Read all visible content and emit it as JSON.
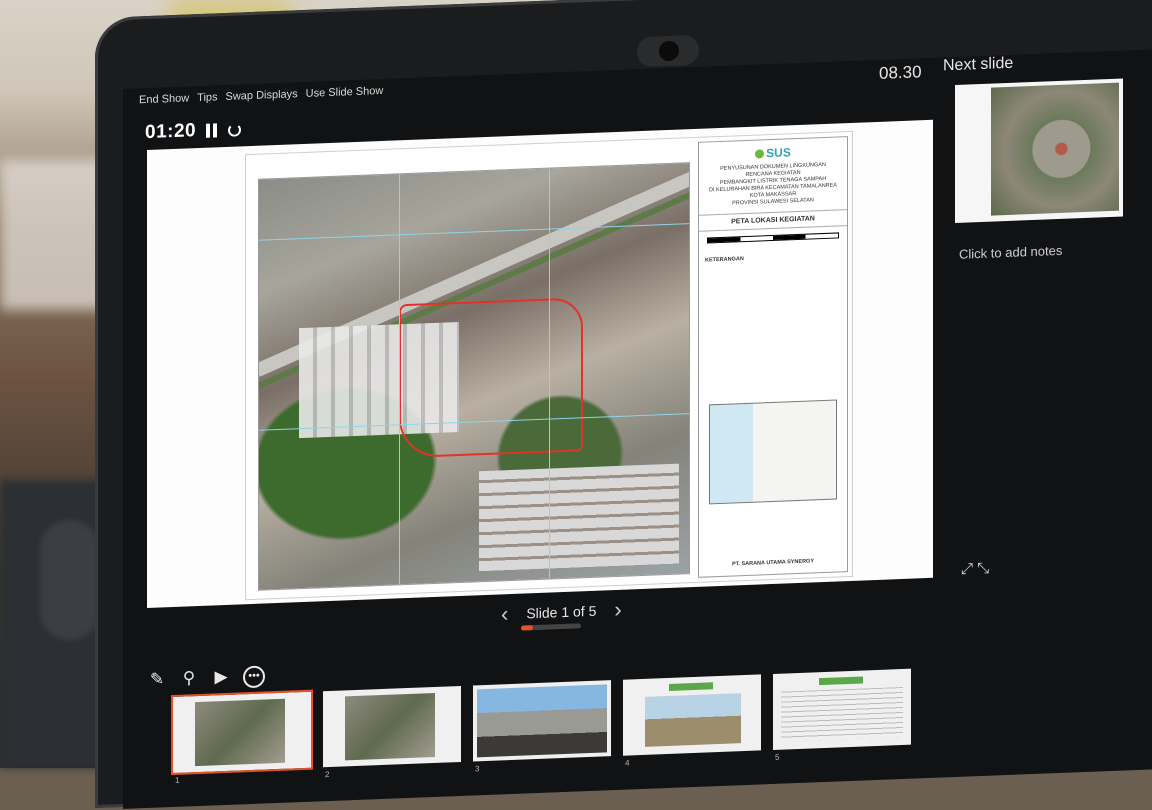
{
  "topbar": {
    "menu": [
      "End Show",
      "Tips",
      "Swap Displays",
      "Use Slide Show"
    ],
    "clock": "08.30",
    "timer": "01:20"
  },
  "slide": {
    "logo_text": "SUS",
    "header_lines": [
      "PENYUSUNAN DOKUMEN LINGKUNGAN",
      "RENCANA KEGIATAN",
      "PEMBANGKIT LISTRIK TENAGA SAMPAH",
      "DI KELURAHAN BIRA KECAMATAN TAMALANREA",
      "KOTA MAKASSAR",
      "PROVINSI SULAWESI SELATAN"
    ],
    "map_title": "PETA LOKASI KEGIATAN",
    "legend_heading": "KETERANGAN",
    "footer_company": "PT. SARANA UTAMA SYNERGY"
  },
  "navigation": {
    "label": "Slide 1 of 5",
    "progress": 0.2
  },
  "next_slide": {
    "label": "Next slide"
  },
  "notes": {
    "placeholder": "Click to add notes"
  },
  "tools": {
    "pen": "pen-icon",
    "zoom": "zoom-icon",
    "pointer": "pointer-icon",
    "more": "more-icon"
  },
  "thumbnails": [
    {
      "num": "1",
      "selected": true
    },
    {
      "num": "2",
      "selected": false
    },
    {
      "num": "3",
      "selected": false
    },
    {
      "num": "4",
      "selected": false
    },
    {
      "num": "5",
      "selected": false
    }
  ],
  "colors": {
    "accent": "#e2532a",
    "boundary": "#e2322a",
    "logo": "#3aa0b8"
  }
}
